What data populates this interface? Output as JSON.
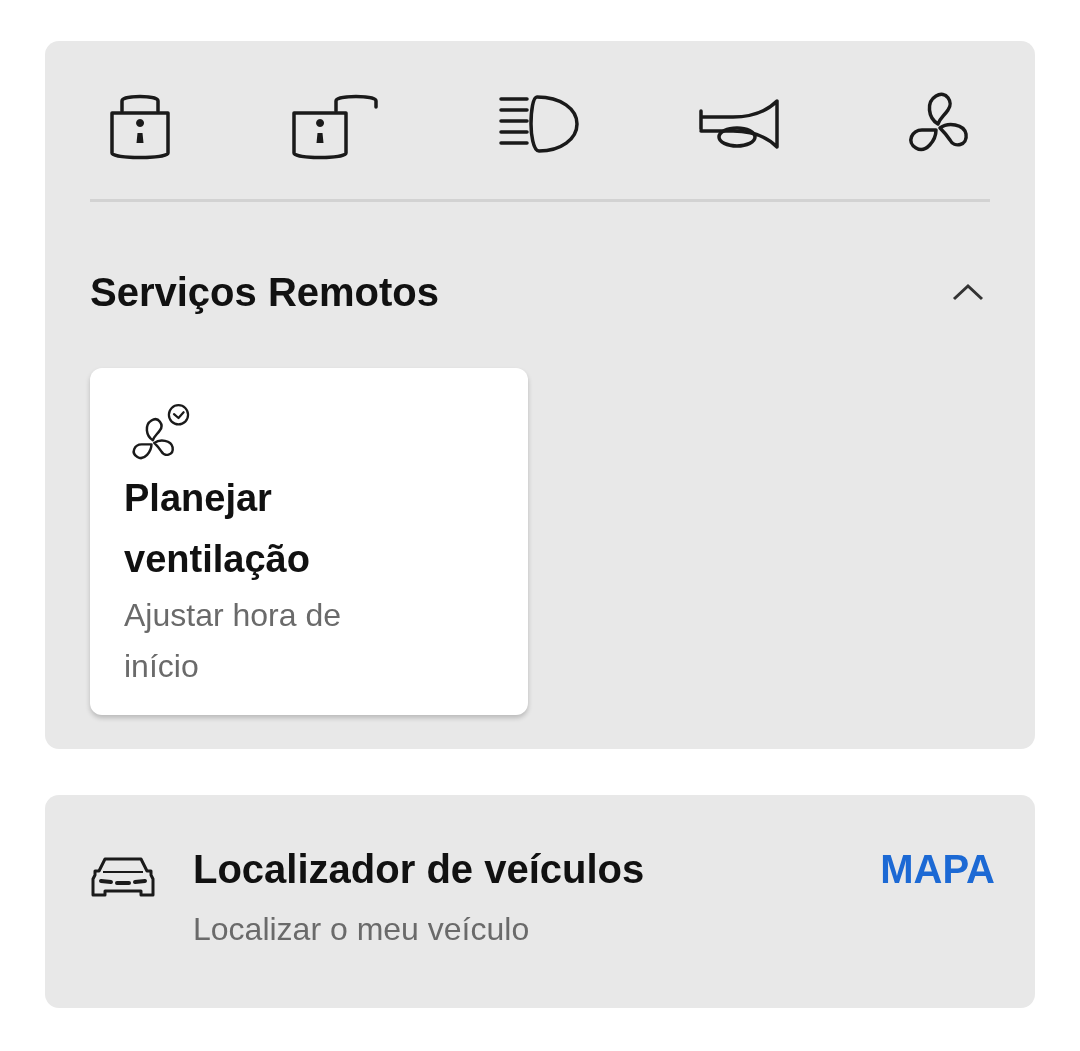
{
  "quick_actions": [
    {
      "kind": "lock"
    },
    {
      "kind": "unlock"
    },
    {
      "kind": "headlights"
    },
    {
      "kind": "horn"
    },
    {
      "kind": "fan"
    }
  ],
  "remote_services": {
    "title": "Serviços Remotos",
    "expanded": true,
    "tiles": [
      {
        "kind": "fan-timer",
        "title": "Planejar ventilação",
        "subtitle": "Ajustar hora de início"
      }
    ]
  },
  "vehicle_finder": {
    "title": "Localizador de veículos",
    "subtitle": "Localizar o meu veículo",
    "action": "MAPA"
  }
}
